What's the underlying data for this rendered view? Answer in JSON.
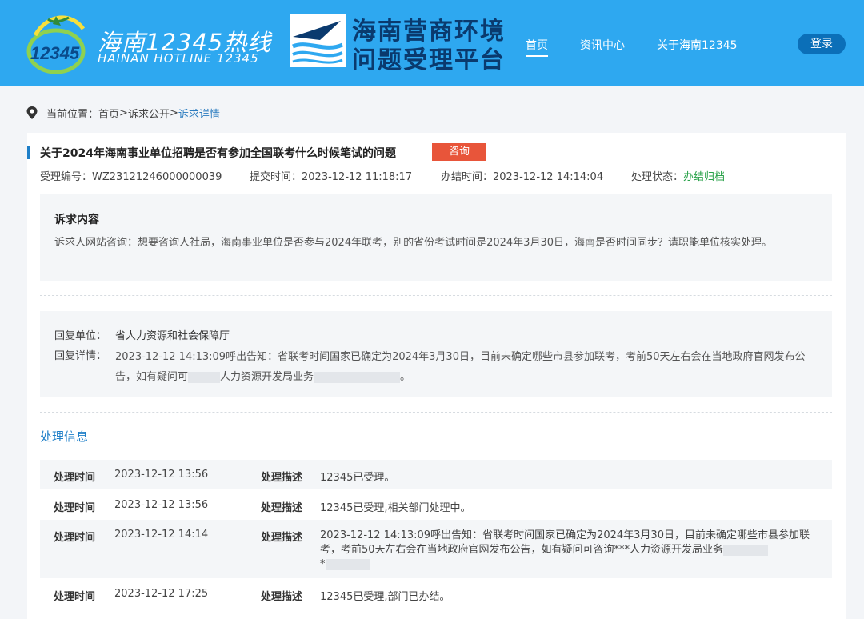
{
  "header": {
    "logo1_title": "海南12345热线",
    "logo1_sub": "HAINAN HOTLINE 12345",
    "logo1_mark": "12345",
    "logo2_line1": "海南营商环境",
    "logo2_line2": "问题受理平台",
    "nav": [
      "首页",
      "资讯中心",
      "关于海南12345"
    ],
    "login": "登录",
    "bg_color": "#2ea8f0"
  },
  "breadcrumb": {
    "prefix": "当前位置：",
    "items": [
      "首页",
      "诉求公开",
      "诉求详情"
    ],
    "sep": " > "
  },
  "case": {
    "title": "关于2024年海南事业单位招聘是否有参加全国联考什么时候笔试的问题",
    "badge": "咨询",
    "id_label": "受理编号：",
    "id": "WZ23121246000000039",
    "submit_label": "提交时间：",
    "submit_time": "2023-12-12 11:18:17",
    "done_label": "办结时间：",
    "done_time": "2023-12-12 14:14:04",
    "status_label": "处理状态：",
    "status": "办结归档"
  },
  "content": {
    "heading": "诉求内容",
    "text": "诉求人网站咨询：想要咨询人社局，海南事业单位是否参与2024年联考，别的省份考试时间是2024年3月30日，海南是否时间同步？请职能单位核实处理。"
  },
  "reply": {
    "unit_label": "回复单位：",
    "unit": "省人力资源和社会保障厅",
    "detail_label": "回复详情：",
    "detail_a": "2023-12-12 14:13:09呼出告知：省联考时间国家已确定为2024年3月30日，目前未确定哪些市县参加联考，考前50天左右会在当地政府官网发布公告，如有疑问可",
    "detail_b": "人力资源开发局业务",
    "detail_c": "。"
  },
  "process": {
    "title": "处理信息",
    "time_label": "处理时间",
    "desc_label": "处理描述",
    "rows": [
      {
        "time": "2023-12-12 13:56",
        "desc": "12345已受理。"
      },
      {
        "time": "2023-12-12 13:56",
        "desc": "12345已受理,相关部门处理中。"
      },
      {
        "time": "2023-12-12 14:14",
        "desc_a": "2023-12-12 14:13:09呼出告知：省联考时间国家已确定为2024年3月30日，目前未确定哪些市县参加联考，考前50天左右会在当地政府官网发布公告，如有疑问可咨询***人力资源开发局业务",
        "desc_b": "*"
      },
      {
        "time": "2023-12-12 17:25",
        "desc": "12345已受理,部门已办结。"
      }
    ]
  },
  "colors": {
    "accent": "#1e7fc8",
    "badge": "#e8553a",
    "status_ok": "#2aa24a",
    "login_btn": "#0b6fb8"
  },
  "icons": [
    "location-pin-icon",
    "hotline-logo-icon",
    "platform-logo-icon"
  ]
}
